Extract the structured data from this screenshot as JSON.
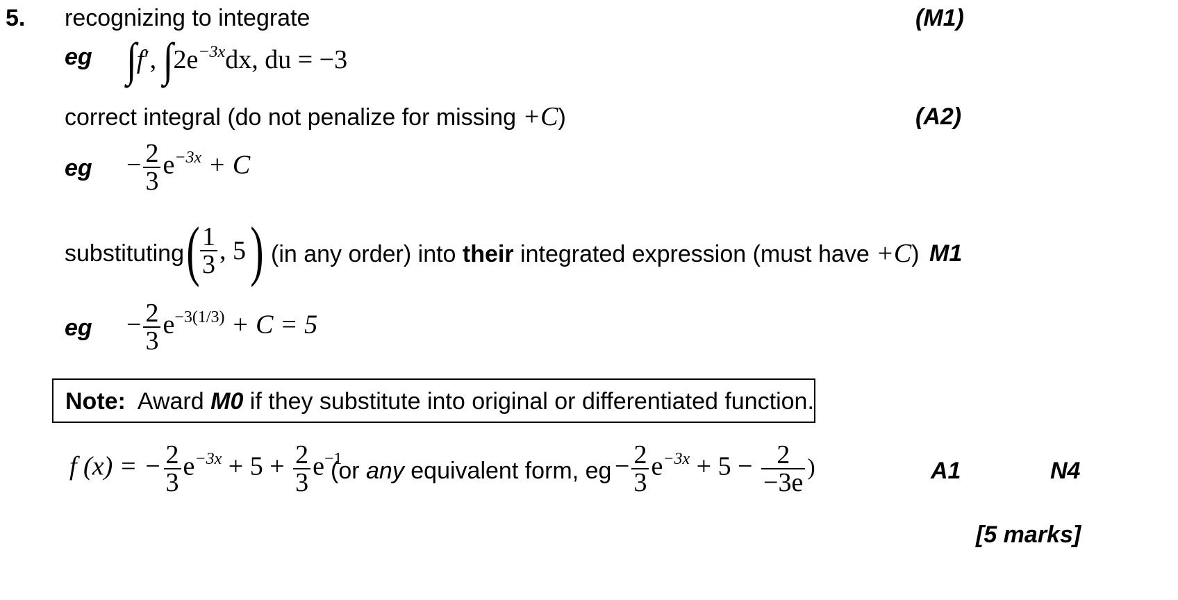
{
  "question": {
    "number": "5.",
    "marks_total": "[5 marks]"
  },
  "step1": {
    "text": "recognizing to integrate",
    "mark": "(M1)",
    "eg": "eg",
    "expr": {
      "f": "f",
      "prime": "′",
      "comma1": ",",
      "integrand": "2e",
      "exp": "−3x",
      "dx": "dx",
      "comma2": ",",
      "du": "du = −3"
    }
  },
  "step2": {
    "text_before": "correct integral (do not penalize for missing ",
    "plusC": "+C",
    "text_after": ")",
    "mark": "(A2)",
    "eg": "eg",
    "expr": {
      "minus": "−",
      "num": "2",
      "den": "3",
      "e": "e",
      "exp": "−3x",
      "tail": " + C"
    }
  },
  "step3": {
    "text_before": "substituting",
    "point_num": "1",
    "point_den": "3",
    "point_sep": ", 5",
    "text_mid1": "(in any order) into ",
    "text_bold": "their",
    "text_mid2": " integrated expression (must have ",
    "plusC": "+C",
    "text_after": ")",
    "mark": "M1",
    "eg": "eg",
    "expr": {
      "minus": "−",
      "num": "2",
      "den": "3",
      "e": "e",
      "exp": "−3(1/3)",
      "tail": " + C = 5"
    }
  },
  "note": {
    "label": "Note:",
    "text_before": "  Award ",
    "mark": "M0",
    "text_after": " if they substitute into original or differentiated function."
  },
  "answer": {
    "lhs": "f (x) = −",
    "num1": "2",
    "den1": "3",
    "e1": "e",
    "exp1": "−3x",
    "mid": " + 5 + ",
    "num2": "2",
    "den2": "3",
    "e2": "e",
    "exp2": "−1",
    "text_before": "(or ",
    "text_italic": "any",
    "text_after": " equivalent form, eg ",
    "alt_minus": "−",
    "alt_num1": "2",
    "alt_den1": "3",
    "alt_e": "e",
    "alt_exp": "−3x",
    "alt_mid": " + 5 − ",
    "alt_num2": "2",
    "alt_den2": "−3e",
    "close": ")",
    "mark": "A1",
    "n_mark": "N4"
  }
}
